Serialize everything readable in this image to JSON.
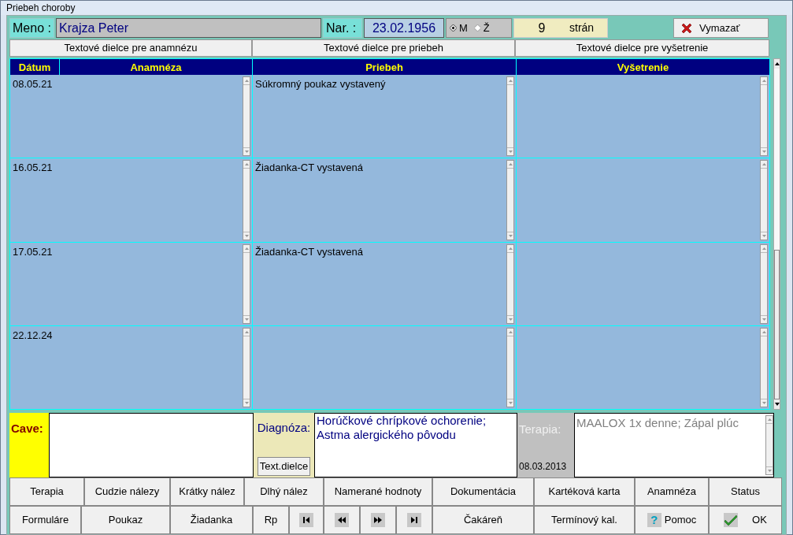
{
  "window": {
    "title": "Priebeh choroby"
  },
  "patient": {
    "name_label": "Meno :",
    "name": "Krajza Peter",
    "birth_label": "Nar. :",
    "birth_date": "23.02.1956",
    "sex": [
      {
        "label": "M",
        "selected": true
      },
      {
        "label": "Ž",
        "selected": false
      }
    ],
    "pages": "9",
    "pages_label": "strán",
    "delete_button": "Vymazať"
  },
  "tabs": [
    {
      "label": "Textové dielce pre anamnézu"
    },
    {
      "label": "Textové dielce pre priebeh"
    },
    {
      "label": "Textové dielce pre vyšetrenie"
    }
  ],
  "columns": [
    "Dátum",
    "Anamnéza",
    "Priebeh",
    "Vyšetrenie"
  ],
  "rows": [
    {
      "date": "08.05.21",
      "priebeh": "Súkromný poukaz vystavený"
    },
    {
      "date": "16.05.21",
      "priebeh": "Žiadanka-CT vystavená"
    },
    {
      "date": "17.05.21",
      "priebeh": "Žiadanka-CT vystavená"
    },
    {
      "date": "22.12.24"
    }
  ],
  "cave": {
    "label": "Cave:"
  },
  "diagnosis": {
    "label": "Diagnóza:",
    "button": "Text.dielce",
    "text": "Horúčkové chrípkové ochorenie; Astma alergického pôvodu"
  },
  "therapy": {
    "label": "Terapia:",
    "date": "08.03.2013",
    "text": "MAALOX 1x denne; Zápal plúc"
  },
  "buttons_row_1": [
    {
      "kind": "text",
      "label": "Terapia"
    },
    {
      "kind": "text",
      "label": "Cudzie nálezy"
    },
    {
      "kind": "text",
      "label": "Krátky nález"
    },
    {
      "kind": "text",
      "label": "Dlhý nález"
    },
    {
      "kind": "text",
      "label": "Namerané hodnoty"
    },
    {
      "kind": "text",
      "label": "Dokumentácia"
    },
    {
      "kind": "text",
      "label": "Kartéková karta"
    },
    {
      "kind": "text",
      "label": "Anamnéza"
    },
    {
      "kind": "text",
      "label": "Status"
    }
  ],
  "buttons_row_2": [
    {
      "kind": "text",
      "label": "Formuláre"
    },
    {
      "kind": "text",
      "label": "Poukaz"
    },
    {
      "kind": "text",
      "label": "Žiadanka"
    },
    {
      "kind": "text",
      "label": "Rp"
    },
    {
      "kind": "first"
    },
    {
      "kind": "prev"
    },
    {
      "kind": "next"
    },
    {
      "kind": "last"
    },
    {
      "kind": "text",
      "label": "Čakáreň"
    },
    {
      "kind": "text",
      "label": "Termínový kal."
    },
    {
      "kind": "help",
      "icon": "?",
      "label": "Pomoc"
    },
    {
      "kind": "ok",
      "label": "OK"
    }
  ]
}
